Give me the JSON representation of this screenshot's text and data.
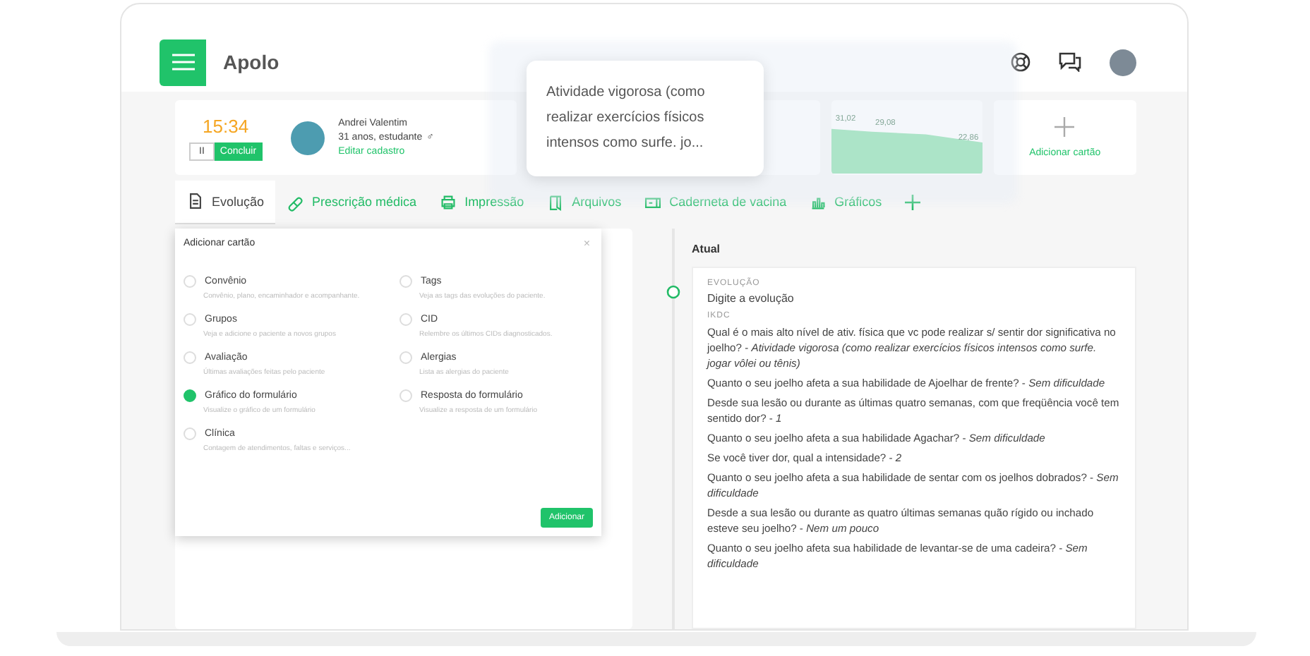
{
  "app": {
    "title": "Apolo"
  },
  "timer": {
    "time": "15:34",
    "pause_label": "II",
    "finish_label": "Concluir"
  },
  "patient": {
    "name": "Andrei Valentim",
    "details": "31 anos, estudante",
    "gender_symbol": "♂",
    "edit_link": "Editar cadastro"
  },
  "tooltip": {
    "text": "Atividade vigorosa (como realizar exercícios físicos intensos como surfe. jo..."
  },
  "chart_card": {
    "labels": [
      "31,02",
      "29,08",
      "22,86"
    ]
  },
  "add_card": {
    "label": "Adicionar cartão"
  },
  "tabs": [
    {
      "label": "Evolução",
      "selected": true
    },
    {
      "label": "Prescrição médica",
      "selected": false
    },
    {
      "label": "Impressão",
      "selected": false
    },
    {
      "label": "Arquivos",
      "selected": false
    },
    {
      "label": "Caderneta de vacina",
      "selected": false
    },
    {
      "label": "Gráficos",
      "selected": false
    }
  ],
  "modal": {
    "title": "Adicionar cartão",
    "close": "×",
    "button": "Adicionar",
    "options": [
      {
        "label": "Convênio",
        "description": "Convênio, plano, encaminhador e acompanhante.",
        "selected": false
      },
      {
        "label": "Tags",
        "description": "Veja as tags das evoluções do paciente.",
        "selected": false
      },
      {
        "label": "Grupos",
        "description": "Veja e adicione o paciente a novos grupos",
        "selected": false
      },
      {
        "label": "CID",
        "description": "Relembre os últimos CIDs diagnosticados.",
        "selected": false
      },
      {
        "label": "Avaliação",
        "description": "Últimas avaliações feitas pelo paciente",
        "selected": false
      },
      {
        "label": "Alergias",
        "description": "Lista as alergias do paciente",
        "selected": false
      },
      {
        "label": "Gráfico do formulário",
        "description": "Visualize o gráfico de um formulário",
        "selected": true
      },
      {
        "label": "Resposta do formulário",
        "description": "Visualize a resposta de um formulário",
        "selected": false
      },
      {
        "label": "Clínica",
        "description": "Contagem de atendimentos, faltas e serviços...",
        "selected": false
      }
    ]
  },
  "timeline": {
    "heading": "Atual",
    "section_label": "EVOLUÇÃO",
    "placeholder": "Digite a evolução",
    "form_label": "IKDC",
    "answers": [
      "Qual é o mais alto nível de ativ. física que vc pode realizar s/ sentir dor significativa no joelho? - *Atividade vigorosa (como realizar exercícios físicos intensos como surfe. jogar vôlei ou tênis)*",
      "Quanto o seu joelho afeta a sua habilidade de Ajoelhar de frente? - *Sem dificuldade*",
      "Desde sua lesão ou durante as últimas quatro semanas, com que freqüência você tem sentido dor? - *1*",
      "Quanto o seu joelho afeta a sua habilidade Agachar? - *Sem dificuldade*",
      "Se você tiver dor, qual a intensidade? - *2*",
      "Quanto o seu joelho afeta a sua habilidade de sentar com os joelhos dobrados? - *Sem dificuldade*",
      "Desde a sua lesão ou durante as quatro últimas semanas quão rígido ou inchado esteve seu joelho? - *Nem um pouco*",
      "Quanto o seu joelho afeta sua habilidade de levantar-se de uma cadeira? - *Sem dificuldade*"
    ]
  }
}
